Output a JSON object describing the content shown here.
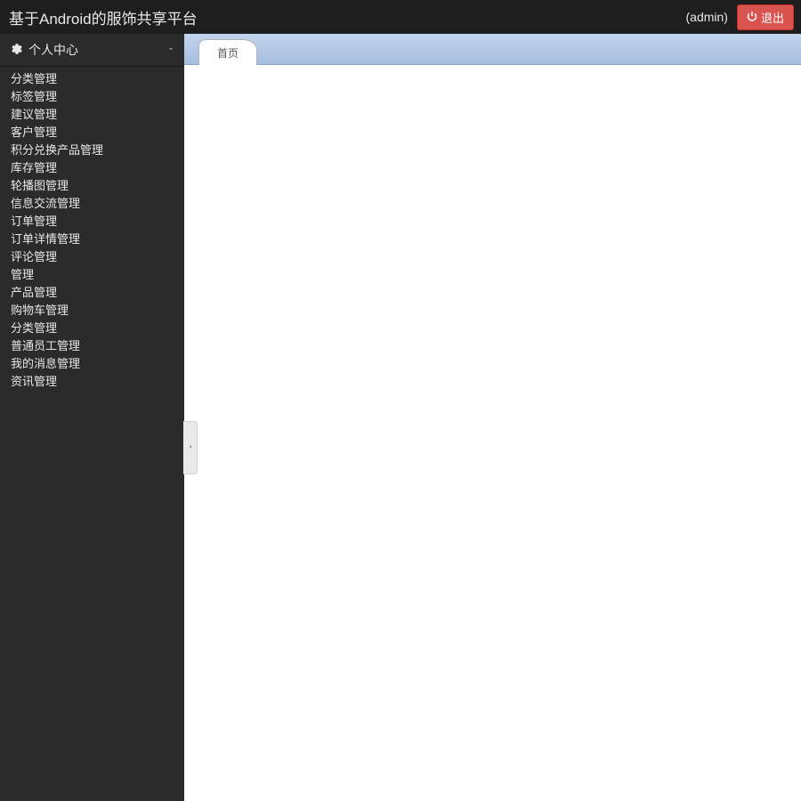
{
  "header": {
    "title": "基于Android的服饰共享平台",
    "user": "(admin)",
    "logout": "退出"
  },
  "sidebar": {
    "header_label": "个人中心",
    "items": [
      "分类管理",
      "标签管理",
      "建议管理",
      "客户管理",
      "积分兑换产品管理",
      "库存管理",
      "轮播图管理",
      "信息交流管理",
      "订单管理",
      "订单详情管理",
      "评论管理",
      "管理",
      "产品管理",
      "购物车管理",
      "分类管理",
      "普通员工管理",
      "我的消息管理",
      "资讯管理"
    ]
  },
  "tabs": {
    "active": "首页"
  }
}
